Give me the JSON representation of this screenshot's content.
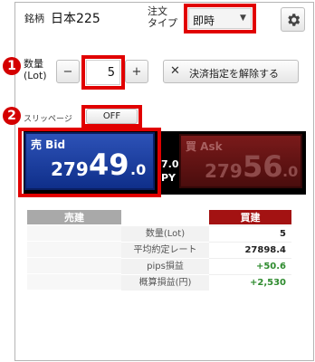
{
  "header": {
    "symbol_label": "銘柄",
    "symbol_value": "日本225",
    "order_type_label_line1": "注文",
    "order_type_label_line2": "タイプ",
    "order_type_value": "即時"
  },
  "annotations": {
    "one": "1",
    "two": "2"
  },
  "quantity": {
    "label_line1": "数量",
    "label_line2": "(Lot)",
    "minus": "−",
    "value": "5",
    "plus": "+"
  },
  "cancel_settlement_label": "決済指定を解除する",
  "slippage": {
    "label": "スリッページ",
    "value": "OFF"
  },
  "bid": {
    "label": "売 Bid",
    "price_prefix": "279",
    "price_big": "49",
    "price_suffix": ".0"
  },
  "spread": {
    "value": "7.0",
    "unit": "PY"
  },
  "ask": {
    "label": "買 Ask",
    "price_prefix": "279",
    "price_big": "56",
    "price_suffix": ".0"
  },
  "positions": {
    "sell_header": "売建",
    "buy_header": "買建",
    "rows": [
      {
        "label": "数量(Lot)",
        "buy_value": "5",
        "color": "#222222"
      },
      {
        "label": "平均約定レート",
        "buy_value": "27898.4",
        "color": "#222222"
      },
      {
        "label": "pips損益",
        "buy_value": "+50.6",
        "color": "#2e8b2e"
      },
      {
        "label": "概算損益(円)",
        "buy_value": "+2,530",
        "color": "#2e8b2e"
      }
    ]
  },
  "colors": {
    "bid": "#1f45a8",
    "ask": "#5e1313",
    "annotation": "#e10000",
    "buy_header": "#a31212"
  }
}
